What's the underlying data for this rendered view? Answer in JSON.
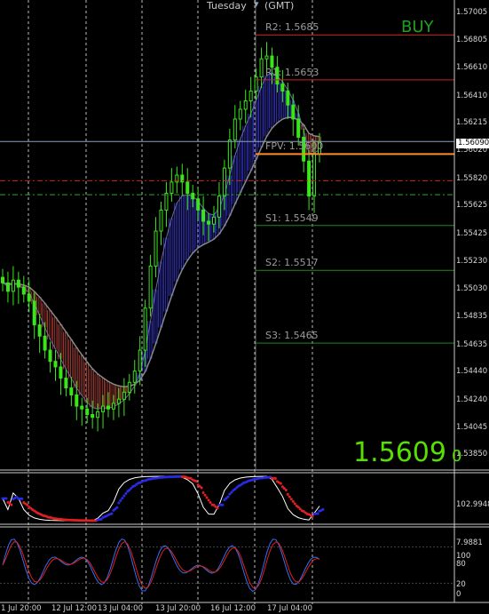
{
  "header": {
    "day": "Tuesday",
    "tz": "(GMT)"
  },
  "signal": "BUY",
  "current_price": {
    "main": "1.5609",
    "tail": "0",
    "box": "1.56090"
  },
  "pivots": [
    {
      "label": "R2:",
      "value": "1.5685",
      "price": 1.5685,
      "color": "#cc2222"
    },
    {
      "label": "R1:",
      "value": "1.5653",
      "price": 1.5653,
      "color": "#cc2222"
    },
    {
      "label": "FPV:",
      "value": "1.5600",
      "price": 1.56,
      "color": "#ff8c2a"
    },
    {
      "label": "S1:",
      "value": "1.5549",
      "price": 1.5549,
      "color": "#1f8a1f"
    },
    {
      "label": "S2:",
      "value": "1.5517",
      "price": 1.5517,
      "color": "#1f8a1f"
    },
    {
      "label": "S3:",
      "value": "1.5465",
      "price": 1.5465,
      "color": "#1f8a1f"
    }
  ],
  "price_axis": [
    "1.57005",
    "1.56805",
    "1.56610",
    "1.56410",
    "1.56215",
    "1.56020",
    "1.55820",
    "1.55625",
    "1.55425",
    "1.55230",
    "1.55030",
    "1.54835",
    "1.54635",
    "1.54440",
    "1.54240",
    "1.54045",
    "1.53850"
  ],
  "time_axis": [
    "1 Jul 20:00",
    "12 Jul 12:00",
    "13 Jul 04:00",
    "13 Jul 20:00",
    "16 Jul 12:00",
    "17 Jul 04:00"
  ],
  "stoch_axis": {
    "top": "102.9948",
    "bottom": "7.9881"
  },
  "osc_axis": {
    "top": "100",
    "mid": "80",
    "low": "20",
    "bottom": "0"
  },
  "chart_data": {
    "type": "candlestick",
    "ylim": [
      1.5375,
      1.571
    ],
    "closes": [
      1.5508,
      1.5502,
      1.551,
      1.5505,
      1.55,
      1.5495,
      1.5478,
      1.547,
      1.546,
      1.5452,
      1.5448,
      1.544,
      1.5433,
      1.5428,
      1.542,
      1.5418,
      1.5414,
      1.5412,
      1.5416,
      1.542,
      1.5418,
      1.5422,
      1.5425,
      1.543,
      1.5437,
      1.5445,
      1.546,
      1.549,
      1.552,
      1.5545,
      1.556,
      1.5572,
      1.558,
      1.5585,
      1.558,
      1.5572,
      1.5568,
      1.556,
      1.5552,
      1.555,
      1.5555,
      1.557,
      1.559,
      1.561,
      1.5625,
      1.5632,
      1.5638,
      1.5645,
      1.5655,
      1.5668,
      1.567,
      1.5662,
      1.565,
      1.5645,
      1.5635,
      1.5625,
      1.5612,
      1.5595,
      1.557,
      1.56,
      1.5609
    ],
    "pivot_levels": [
      1.5685,
      1.5653,
      1.56,
      1.5549,
      1.5517,
      1.5465
    ],
    "current": 1.5609
  }
}
